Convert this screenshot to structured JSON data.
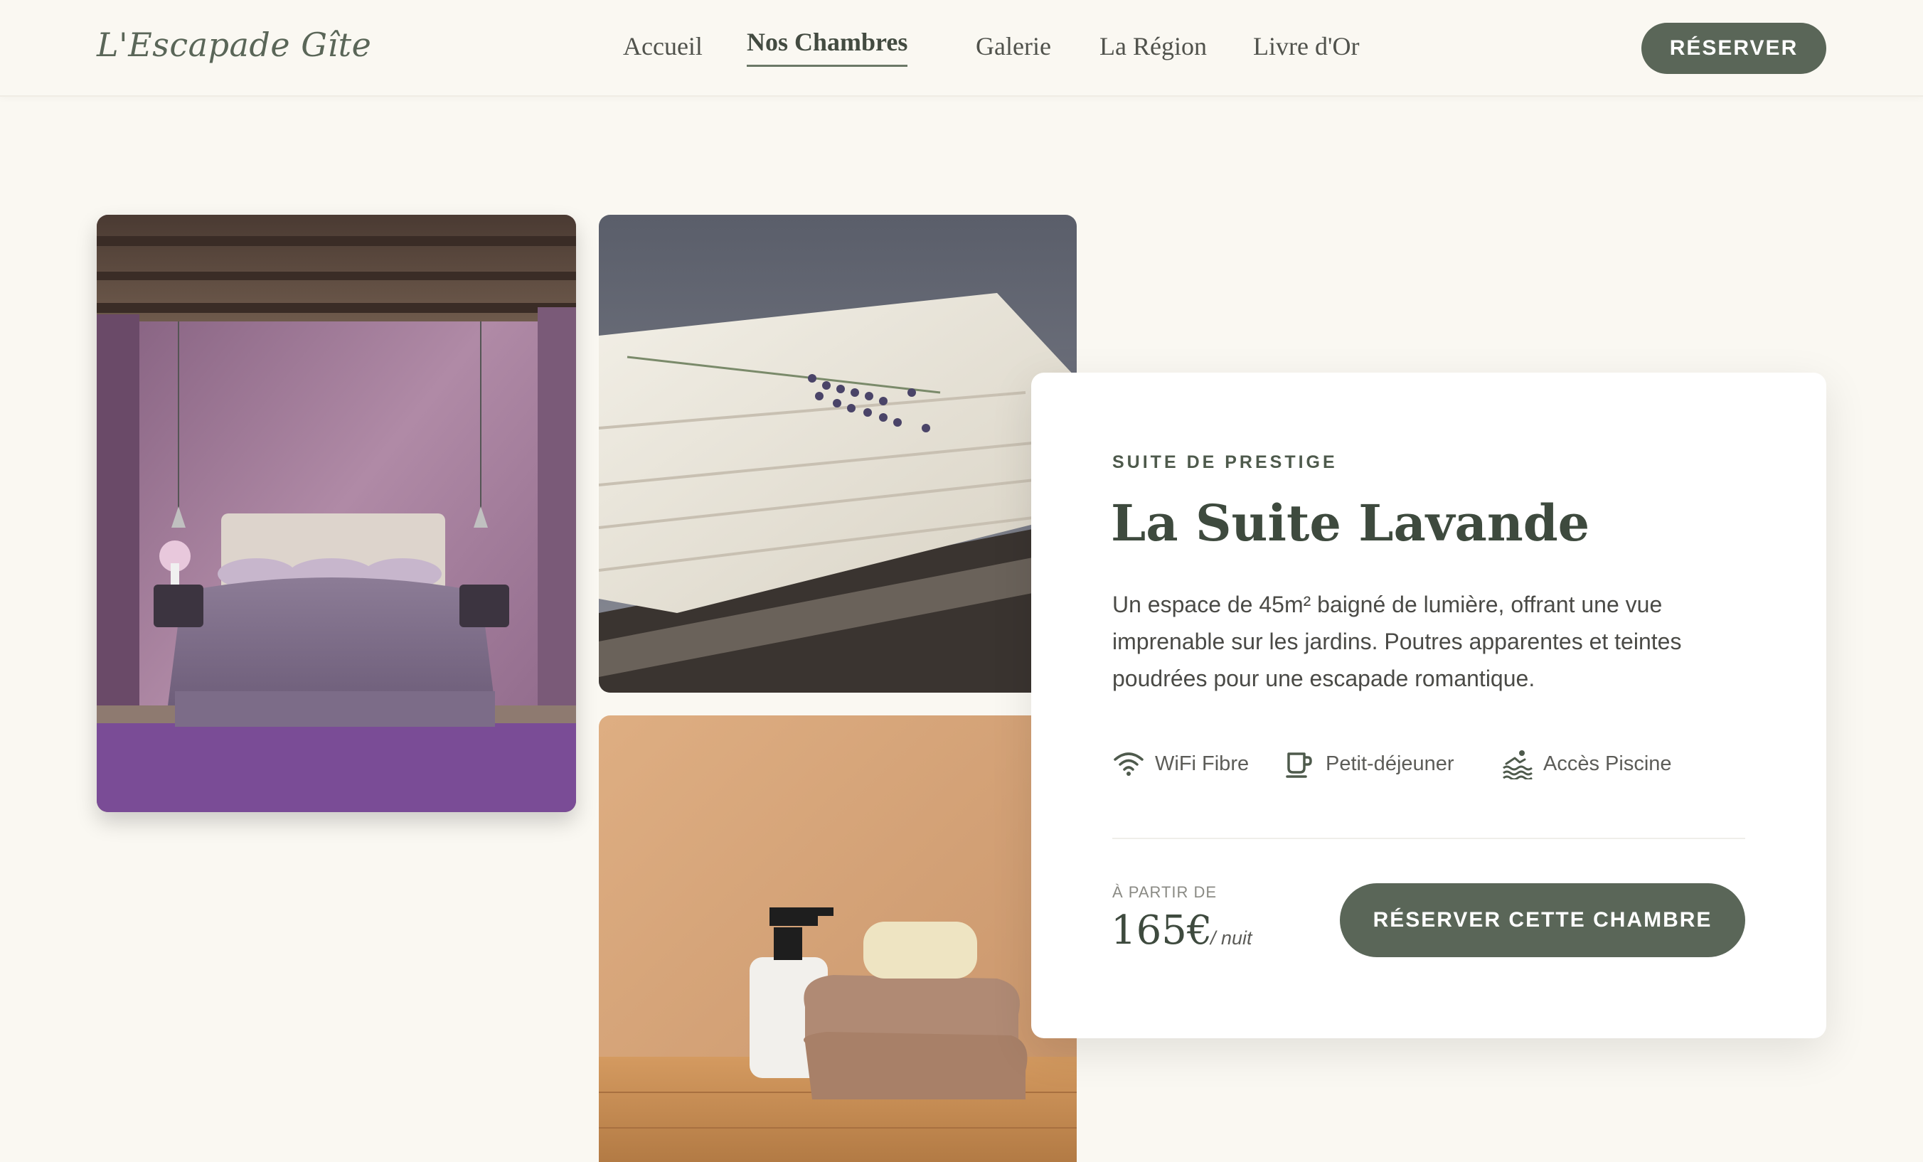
{
  "header": {
    "logo": "L'Escapade Gîte",
    "nav": [
      {
        "label": "Accueil",
        "active": false
      },
      {
        "label": "Nos Chambres",
        "active": true
      },
      {
        "label": "Galerie",
        "active": false
      },
      {
        "label": "La Région",
        "active": false
      },
      {
        "label": "Livre d'Or",
        "active": false
      }
    ],
    "cta": "RÉSERVER"
  },
  "room": {
    "eyebrow": "SUITE DE PRESTIGE",
    "title": "La Suite Lavande",
    "description": "Un espace de 45m² baigné de lumière, offrant une vue imprenable sur les jardins. Poutres apparentes et teintes poudrées pour une escapade romantique.",
    "amenities": [
      {
        "icon": "wifi-icon",
        "label": "WiFi Fibre"
      },
      {
        "icon": "coffee-cup-icon",
        "label": "Petit-déjeuner"
      },
      {
        "icon": "swimmer-icon",
        "label": "Accès Piscine"
      }
    ],
    "price_label": "À PARTIR DE",
    "price": "165€",
    "price_unit": "/ nuit",
    "cta": "RÉSERVER CETTE CHAMBRE"
  },
  "gallery": [
    {
      "name": "lavender-bedroom-photo"
    },
    {
      "name": "folded-linen-lavender-photo"
    },
    {
      "name": "soap-towels-photo"
    }
  ],
  "colors": {
    "background": "#faf8f2",
    "accent": "#5a6658",
    "card": "#ffffff"
  }
}
